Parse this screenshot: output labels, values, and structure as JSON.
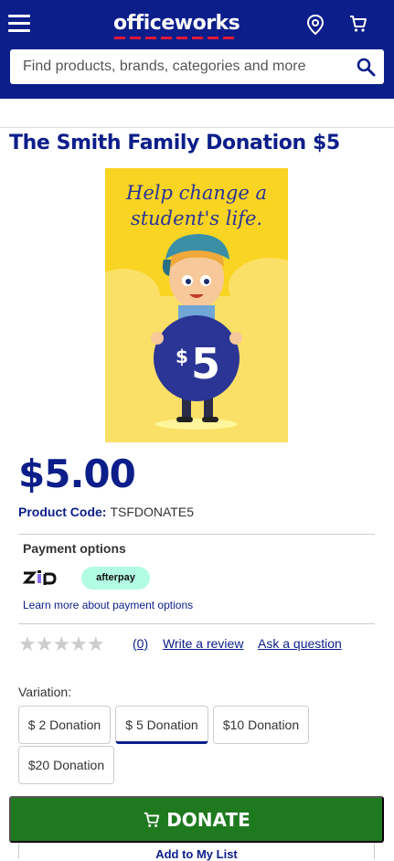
{
  "header": {
    "logo": "officeworks",
    "search_placeholder": "Find products, brands, categories and more"
  },
  "product": {
    "title": "The Smith Family Donation $5",
    "image_text_line1": "Help change a",
    "image_text_line2": "student's life.",
    "image_amount": "5",
    "image_currency": "$",
    "price": "$5.00",
    "code_label": "Product Code:",
    "code_value": "TSFDONATE5"
  },
  "payment": {
    "title": "Payment options",
    "zip": "ZIP",
    "afterpay": "afterpay",
    "learn_more": "Learn more about payment options"
  },
  "reviews": {
    "stars": "★★★★★",
    "rating": 0,
    "count": "(0)",
    "write": "Write a review",
    "ask": "Ask a question"
  },
  "variation": {
    "label": "Variation:",
    "options": [
      "$ 2 Donation",
      "$ 5 Donation",
      "$10 Donation",
      "$20 Donation"
    ],
    "selected": "$ 5 Donation"
  },
  "actions": {
    "donate": "DONATE",
    "add_to_list": "Add to My List"
  },
  "colors": {
    "brand_navy": "#0b1e8a",
    "brand_red": "#e31837",
    "donate_green": "#1f7a1f",
    "afterpay_mint": "#b2fce4",
    "image_yellow": "#f9d423"
  }
}
